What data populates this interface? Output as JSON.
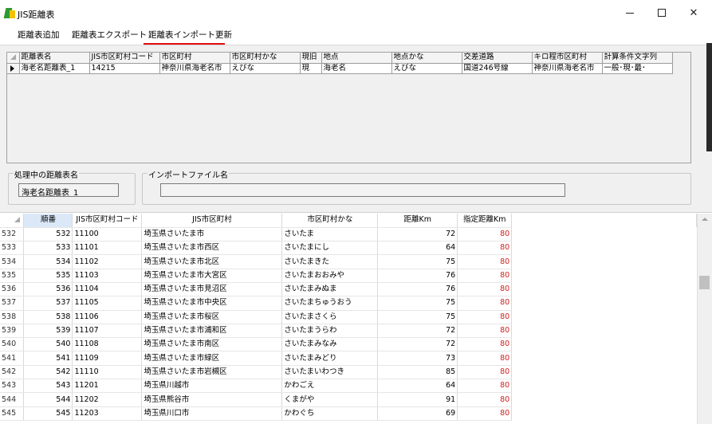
{
  "window": {
    "title": "JIS距離表"
  },
  "menu": {
    "items": [
      "距離表追加",
      "距離表エクスポート",
      "距離表インポート更新"
    ]
  },
  "upper_grid": {
    "columns": [
      "距離表名",
      "JIS市区町村コード",
      "市区町村",
      "市区町村かな",
      "現旧",
      "地点",
      "地点かな",
      "交差道路",
      "キロ程市区町村",
      "計算条件文字列"
    ],
    "rows": [
      [
        "海老名距離表_1",
        "14215",
        "神奈川県海老名市",
        "えびな",
        "現",
        "海老名",
        "えびな",
        "国道246号線",
        "神奈川県海老名市",
        "一般･現･最･"
      ]
    ]
  },
  "processing": {
    "label": "処理中の距離表名",
    "value": "海老名距離表_1"
  },
  "import_file": {
    "label": "インポートファイル名",
    "value": ""
  },
  "lower_grid": {
    "columns": [
      "順番",
      "JIS市区町村コード",
      "JIS市区町村",
      "市区町村かな",
      "距離Km",
      "指定距離Km"
    ],
    "rows": [
      [
        "532",
        "532",
        "11100",
        "埼玉県さいたま市",
        "さいたま",
        "72",
        "80"
      ],
      [
        "533",
        "533",
        "11101",
        "埼玉県さいたま市西区",
        "さいたまにし",
        "64",
        "80"
      ],
      [
        "534",
        "534",
        "11102",
        "埼玉県さいたま市北区",
        "さいたまきた",
        "75",
        "80"
      ],
      [
        "535",
        "535",
        "11103",
        "埼玉県さいたま市大宮区",
        "さいたまおおみや",
        "76",
        "80"
      ],
      [
        "536",
        "536",
        "11104",
        "埼玉県さいたま市見沼区",
        "さいたまみぬま",
        "76",
        "80"
      ],
      [
        "537",
        "537",
        "11105",
        "埼玉県さいたま市中央区",
        "さいたまちゅうおう",
        "75",
        "80"
      ],
      [
        "538",
        "538",
        "11106",
        "埼玉県さいたま市桜区",
        "さいたまさくら",
        "75",
        "80"
      ],
      [
        "539",
        "539",
        "11107",
        "埼玉県さいたま市浦和区",
        "さいたまうらわ",
        "72",
        "80"
      ],
      [
        "540",
        "540",
        "11108",
        "埼玉県さいたま市南区",
        "さいたまみなみ",
        "72",
        "80"
      ],
      [
        "541",
        "541",
        "11109",
        "埼玉県さいたま市緑区",
        "さいたまみどり",
        "73",
        "80"
      ],
      [
        "542",
        "542",
        "11110",
        "埼玉県さいたま市岩槻区",
        "さいたまいわつき",
        "85",
        "80"
      ],
      [
        "543",
        "543",
        "11201",
        "埼玉県川越市",
        "かわごえ",
        "64",
        "80"
      ],
      [
        "544",
        "544",
        "11202",
        "埼玉県熊谷市",
        "くまがや",
        "91",
        "80"
      ],
      [
        "545",
        "545",
        "11203",
        "埼玉県川口市",
        "かわぐち",
        "69",
        "80"
      ]
    ]
  },
  "colors": {
    "highlight": "#e01010",
    "designated_distance": "#d02020",
    "selected_header": "#dbe8f7"
  },
  "icons": [
    "app-icon",
    "minimize-icon",
    "maximize-icon",
    "close-icon",
    "row-pointer-icon",
    "scroll-up-icon"
  ]
}
